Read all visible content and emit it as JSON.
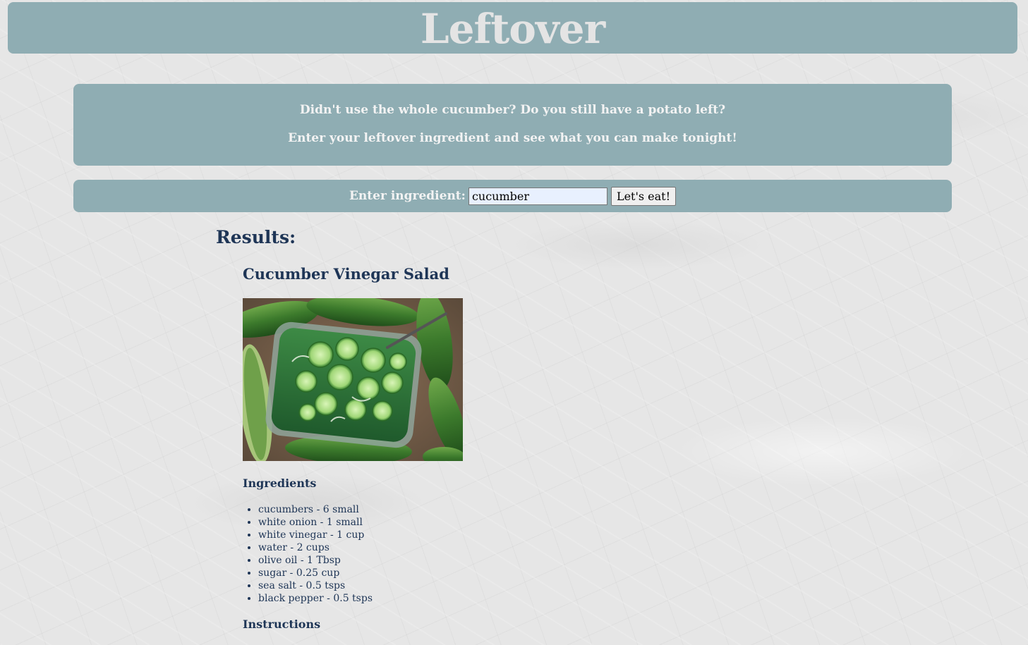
{
  "header": {
    "title": "Leftover"
  },
  "intro": {
    "line1": "Didn't use the whole cucumber? Do you still have a potato left?",
    "line2": "Enter your leftover ingredient and see what you can make tonight!"
  },
  "search": {
    "label": "Enter ingredient:",
    "value": "cucumber",
    "button_label": "Let's eat!"
  },
  "results": {
    "heading": "Results:",
    "recipes": [
      {
        "title": "Cucumber Vinegar Salad",
        "ingredients_heading": "Ingredients",
        "ingredients": [
          "cucumbers - 6 small",
          "white onion - 1 small",
          "white vinegar - 1 cup",
          "water - 2 cups",
          "olive oil - 1 Tbsp",
          "sugar - 0.25 cup",
          "sea salt - 0.5 tsps",
          "black pepper - 0.5 tsps"
        ],
        "instructions_heading": "Instructions"
      }
    ]
  },
  "colors": {
    "panel": "#8fadb3",
    "text_dark": "#1e3556",
    "text_light": "#f3f3f3",
    "title_color": "#e4e4e4",
    "background": "#e6e6e6",
    "input_background": "#e8f0fe"
  }
}
